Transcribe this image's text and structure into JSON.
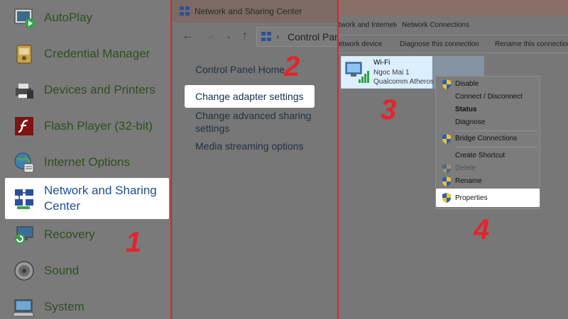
{
  "panel1": {
    "items": [
      {
        "label": "AutoPlay",
        "icon": "autoplay-icon"
      },
      {
        "label": "Credential Manager",
        "icon": "credential-manager-icon"
      },
      {
        "label": "Devices and Printers",
        "icon": "printer-icon"
      },
      {
        "label": "Flash Player (32-bit)",
        "icon": "flash-icon"
      },
      {
        "label": "Internet Options",
        "icon": "globe-icon"
      },
      {
        "label": "Network and Sharing Center",
        "icon": "network-icon"
      },
      {
        "label": "Recovery",
        "icon": "recovery-icon"
      },
      {
        "label": "Sound",
        "icon": "speaker-icon"
      },
      {
        "label": "System",
        "icon": "computer-icon"
      }
    ],
    "step": "1"
  },
  "panel2": {
    "window_title": "Network and Sharing Center",
    "address": "Control Panel",
    "tasks": {
      "home": "Control Panel Home",
      "adapter": "Change adapter settings",
      "advanced": "Change advanced sharing settings",
      "media": "Media streaming options"
    },
    "step": "2"
  },
  "panel3": {
    "breadcrumb": {
      "parent": "twork and Internet",
      "sep": "›",
      "current": "Network Connections"
    },
    "commands": {
      "a": "etwork device",
      "b": "Diagnose this connection",
      "c": "Rename this connection"
    },
    "adapter": {
      "name": "Wi-Fi",
      "network": "Ngoc Mai 1",
      "device": "Qualcomm Atheros"
    },
    "menu": {
      "disable": "Disable",
      "connect": "Connect / Disconnect",
      "status": "Status",
      "diagnose": "Diagnose",
      "bridge": "Bridge Connections",
      "shortcut": "Create Shortcut",
      "delete": "Delete",
      "rename": "Rename",
      "properties": "Properties"
    },
    "steps": {
      "adapter": "3",
      "properties": "4"
    }
  },
  "colors": {
    "step_red": "#e5232b",
    "divider": "#d8262e",
    "highlight": "#ffffff",
    "selection": "#dcefff"
  }
}
